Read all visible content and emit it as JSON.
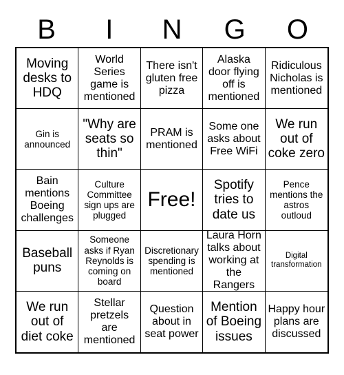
{
  "card": {
    "header_letters": [
      "B",
      "I",
      "N",
      "G",
      "O"
    ],
    "cells": [
      {
        "text": "Moving desks to HDQ",
        "size": "lg"
      },
      {
        "text": "World Series game is mentioned",
        "size": "md"
      },
      {
        "text": "There isn't gluten free pizza",
        "size": "md"
      },
      {
        "text": "Alaska door flying off is mentioned",
        "size": "md"
      },
      {
        "text": "Ridiculous Nicholas is mentioned",
        "size": "md"
      },
      {
        "text": "Gin is announced",
        "size": "sm"
      },
      {
        "text": "\"Why are seats so thin\"",
        "size": "lg"
      },
      {
        "text": "PRAM is mentioned",
        "size": "md"
      },
      {
        "text": "Some one asks about Free WiFi",
        "size": "md"
      },
      {
        "text": "We run out of coke zero",
        "size": "lg"
      },
      {
        "text": "Bain mentions Boeing challenges",
        "size": "md"
      },
      {
        "text": "Culture Committee sign ups are plugged",
        "size": "sm"
      },
      {
        "text": "Free!",
        "size": "xl"
      },
      {
        "text": "Spotify tries to date us",
        "size": "lg"
      },
      {
        "text": "Pence mentions the astros outloud",
        "size": "sm"
      },
      {
        "text": "Baseball puns",
        "size": "lg"
      },
      {
        "text": "Someone asks if Ryan Reynolds is coming on board",
        "size": "sm"
      },
      {
        "text": "Discretionary spending is mentioned",
        "size": "sm"
      },
      {
        "text": "Laura Horn talks about working at the Rangers",
        "size": "md"
      },
      {
        "text": "Digital transformation",
        "size": "xs"
      },
      {
        "text": "We run out of diet coke",
        "size": "lg"
      },
      {
        "text": "Stellar pretzels are mentioned",
        "size": "md"
      },
      {
        "text": "Question about in seat power",
        "size": "md"
      },
      {
        "text": "Mention of Boeing issues",
        "size": "lg"
      },
      {
        "text": "Happy hour plans are discussed",
        "size": "md"
      }
    ]
  }
}
